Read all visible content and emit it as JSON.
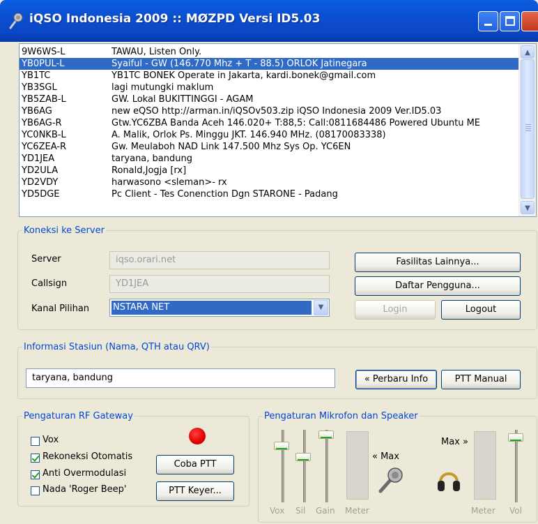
{
  "window": {
    "title": "iQSO Indonesia 2009 :: MØZPD Versi ID5.03"
  },
  "stations": [
    {
      "call": "9W6WS-L",
      "info": "TAWAU, Listen Only."
    },
    {
      "call": "YB0PUL-L",
      "info": "Syaiful - GW (146.770 Mhz + T - 88.5) ORLOK Jatinegara"
    },
    {
      "call": "YB1TC",
      "info": "YB1TC BONEK Operate in Jakarta, kardi.bonek@gmail.com"
    },
    {
      "call": "YB3SGL",
      "info": "lagi mutungki maklum"
    },
    {
      "call": "YB5ZAB-L",
      "info": "GW. Lokal BUKITTINGGI - AGAM"
    },
    {
      "call": "YB6AG",
      "info": "new eQSO http://arman.in/iQSOv503.zip    iQSO Indonesia 2009 Ver.ID5.03"
    },
    {
      "call": "YB6AG-R",
      "info": "Gtw.YC6ZBA Banda Aceh 146.020+ T:88,5: Call:0811684486 Powered Ubuntu ME"
    },
    {
      "call": "YC0NKB-L",
      "info": "A. Malik, Orlok Ps. Minggu JKT. 146.940 MHz. (08170083338)"
    },
    {
      "call": "YC6ZEA-R",
      "info": "Gw. Meulaboh  NAD Link 147.500 Mhz Sys Op. YC6EN"
    },
    {
      "call": "YD1JEA",
      "info": "taryana, bandung"
    },
    {
      "call": "YD2ULA",
      "info": "Ronald,Jogja [rx]"
    },
    {
      "call": "YD2VDY",
      "info": "harwasono <sleman>- rx"
    },
    {
      "call": "YD5DGE",
      "info": "Pc Client - Tes Conenction Dgn STARONE - Padang"
    }
  ],
  "koneksi": {
    "legend": "Koneksi ke Server",
    "server_label": "Server",
    "server_value": "iqso.orari.net",
    "callsign_label": "Callsign",
    "callsign_value": "YD1JEA",
    "kanal_label": "Kanal Pilihan",
    "kanal_value": "NSTARA NET",
    "fasilitas_button": "Fasilitas Lainnya...",
    "daftar_button": "Daftar Pengguna...",
    "login_button": "Login",
    "logout_button": "Logout"
  },
  "info": {
    "legend": "Informasi Stasiun (Nama, QTH atau QRV)",
    "value": "taryana, bandung",
    "perbaru_button": "« Perbaru Info",
    "ptt_manual_button": "PTT Manual"
  },
  "rf": {
    "legend": "Pengaturan RF Gateway",
    "vox": "Vox",
    "rekoneksi": "Rekoneksi Otomatis",
    "anti": "Anti Overmodulasi",
    "nada": "Nada 'Roger Beep'",
    "coba_button": "Coba PTT",
    "keyer_button": "PTT Keyer...",
    "vox_checked": false,
    "rekoneksi_checked": true,
    "anti_checked": true,
    "nada_checked": false
  },
  "audio": {
    "legend": "Pengaturan Mikrofon dan Speaker",
    "mic_max": "« Max",
    "spk_max": "Max »",
    "cap_vox": "Vox",
    "cap_sil": "Sil",
    "cap_gain": "Gain",
    "cap_meter1": "Meter",
    "cap_meter2": "Meter",
    "cap_vol": "Vol"
  },
  "colors": {
    "accent": "#316ac5",
    "legend": "#0046d5",
    "led": "#e00000"
  }
}
